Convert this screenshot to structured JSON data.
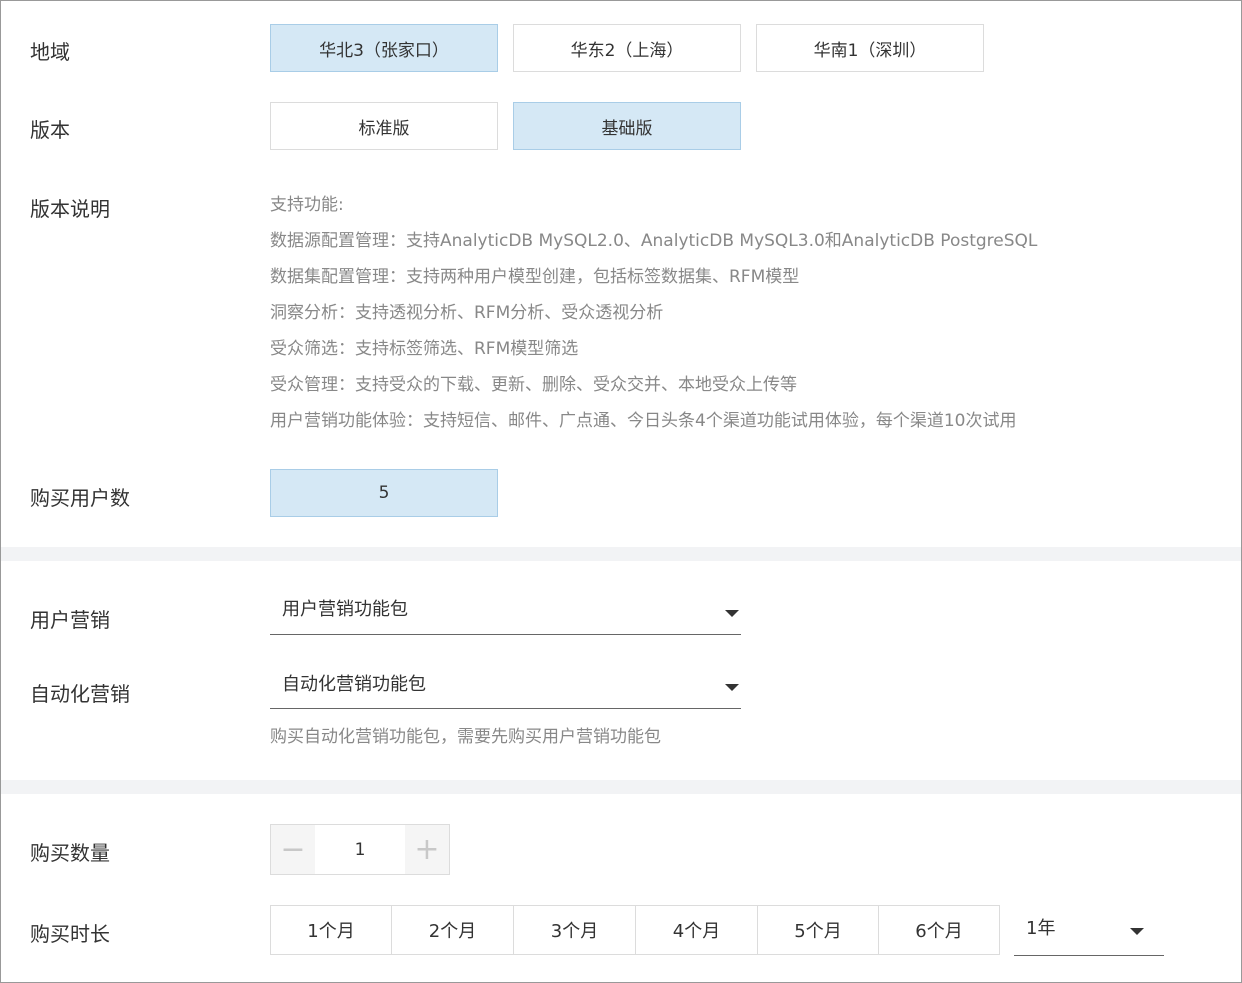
{
  "region": {
    "label": "地域",
    "options": [
      "华北3（张家口）",
      "华东2（上海）",
      "华南1（深圳）"
    ],
    "selected_index": 0
  },
  "edition": {
    "label": "版本",
    "options": [
      "标准版",
      "基础版"
    ],
    "selected_index": 1
  },
  "edition_desc": {
    "label": "版本说明",
    "lines": [
      "支持功能:",
      "数据源配置管理：支持AnalyticDB MySQL2.0、AnalyticDB MySQL3.0和AnalyticDB PostgreSQL",
      "数据集配置管理：支持两种用户模型创建，包括标签数据集、RFM模型",
      "洞察分析：支持透视分析、RFM分析、受众透视分析",
      "受众筛选：支持标签筛选、RFM模型筛选",
      "受众管理：支持受众的下载、更新、删除、受众交并、本地受众上传等",
      "用户营销功能体验：支持短信、邮件、广点通、今日头条4个渠道功能试用体验，每个渠道10次试用"
    ]
  },
  "users": {
    "label": "购买用户数",
    "value": "5"
  },
  "user_marketing": {
    "label": "用户营销",
    "value": "用户营销功能包"
  },
  "auto_marketing": {
    "label": "自动化营销",
    "value": "自动化营销功能包",
    "hint": "购买自动化营销功能包，需要先购买用户营销功能包"
  },
  "quantity": {
    "label": "购买数量",
    "value": "1",
    "minus": "−",
    "plus": "+"
  },
  "duration": {
    "label": "购买时长",
    "options": [
      "1个月",
      "2个月",
      "3个月",
      "4个月",
      "5个月",
      "6个月"
    ],
    "select_value": "1年"
  },
  "colors": {
    "selected_bg": "#d5e8f5",
    "selected_border": "#a9cde7",
    "section_band": "#f2f3f5"
  }
}
